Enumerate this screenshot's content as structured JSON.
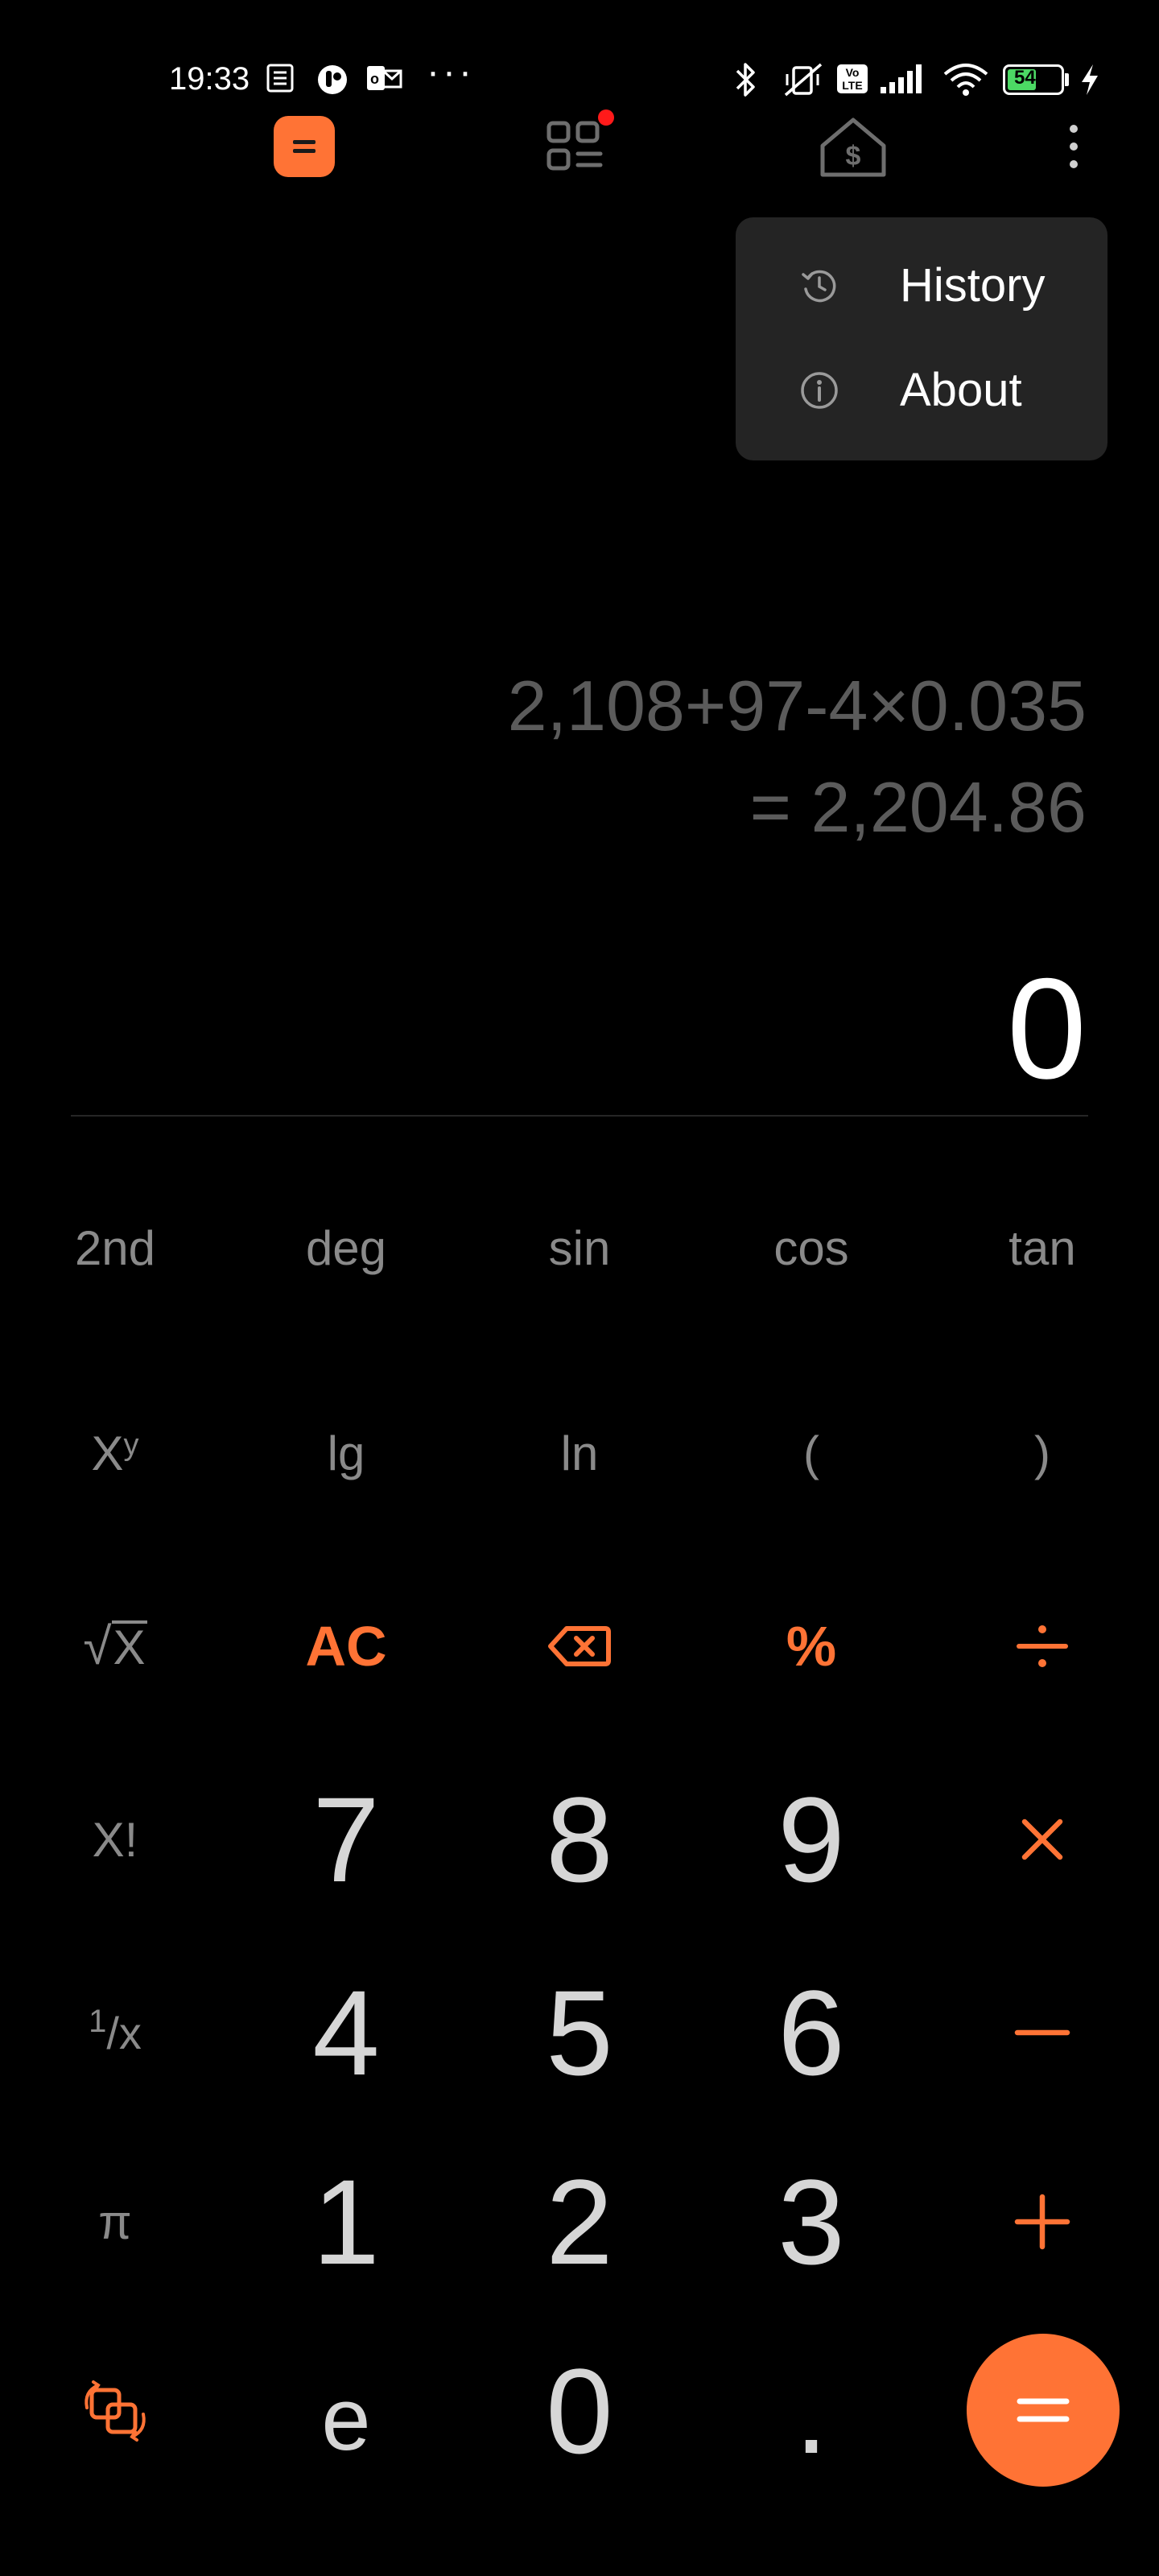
{
  "status_bar": {
    "time": "19:33",
    "battery": "54",
    "overflow_dots": "···",
    "network_badge": "Vo LTE"
  },
  "top_bar": {
    "tabs": [
      {
        "icon": "calculator-icon",
        "active": true
      },
      {
        "icon": "converter-grid-icon",
        "badge": true
      },
      {
        "icon": "mortgage-house-icon"
      }
    ],
    "more_icon": "more-vertical-icon"
  },
  "menu": {
    "items": [
      {
        "label": "History",
        "icon": "history-icon"
      },
      {
        "label": "About",
        "icon": "info-icon"
      }
    ]
  },
  "display": {
    "expression": "2,108+97-4×0.035",
    "result": "= 2,204.86",
    "current": "0"
  },
  "keypad": {
    "row1": [
      "2nd",
      "deg",
      "sin",
      "cos",
      "tan"
    ],
    "row2": [
      "x",
      "lg",
      "ln",
      "(",
      ")"
    ],
    "row2_exponent": "y",
    "row3_sqrt_x": "X",
    "row3_ac": "AC",
    "row3_percent": "%",
    "row4": [
      "X!",
      "7",
      "8",
      "9"
    ],
    "row5": [
      "4",
      "5",
      "6"
    ],
    "row5_reciprocal": "1",
    "row5_reciprocal_den": "x",
    "row6": [
      "π",
      "1",
      "2",
      "3"
    ],
    "row7": [
      "e",
      "0",
      "."
    ]
  },
  "colors": {
    "accent": "#ff7335",
    "background": "#000000",
    "menu_bg": "#242424",
    "expression": "#5b5b5b",
    "function_key": "#8a8a8a",
    "number_key": "#d6d6d6"
  }
}
